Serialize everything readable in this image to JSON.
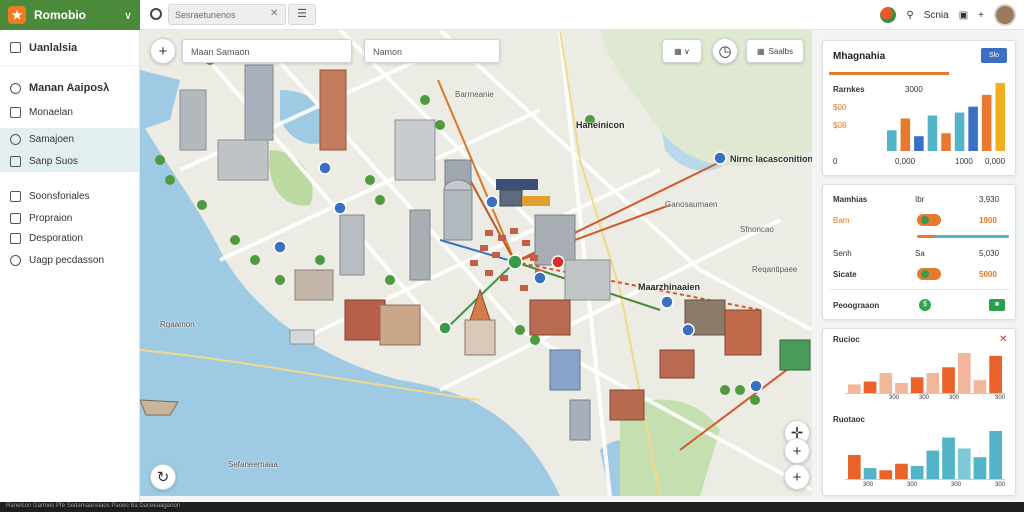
{
  "app": {
    "brand": "Romobio",
    "top_search_placeholder": "Sesraetunenos",
    "top_right_text": "Scnia",
    "top_right_extra": "+"
  },
  "sidebar": {
    "header": "Uanlalsia",
    "items": [
      {
        "label": "Manan Aaiposλ",
        "icon": "user-icon"
      },
      {
        "label": "Monaelan",
        "icon": "calendar-icon"
      },
      {
        "label": "Samajoen",
        "icon": "search-icon"
      },
      {
        "label": "Sanp Suos",
        "icon": "grid-icon"
      },
      {
        "label": "Soonsforiales",
        "icon": "tag-icon"
      },
      {
        "label": "Propraion",
        "icon": "folder-icon"
      },
      {
        "label": "Desporation",
        "icon": "list-icon"
      },
      {
        "label": "Uagp pecdasson",
        "icon": "bolt-icon"
      }
    ]
  },
  "map": {
    "search1": "Maan Samaon",
    "search2": "Namon",
    "labels": {
      "l1": "Haneinicon",
      "l2": "Nirnc Iacasconition",
      "l3": "Maarzhinaaien",
      "l4": "Ganosaumaen",
      "l5": "Barmeanie"
    },
    "small_labels": [
      "Sfnoncao",
      "Reqantipaee",
      "Rgaamon",
      "Sefaneemaaa"
    ],
    "pill2": "Saalbs",
    "zoom_in": "+",
    "zoom_out": "+"
  },
  "panel1": {
    "title": "Mhagnahia",
    "badge": "Slo",
    "rows": [
      {
        "left": "Rarnkes",
        "right": "3000"
      },
      {
        "left": "$00",
        "right": ""
      },
      {
        "left": "$08",
        "right": ""
      },
      {
        "left": "0",
        "right": "0,000"
      }
    ],
    "axis": [
      "1000",
      "0,000"
    ],
    "chart_values": [
      14,
      22,
      10,
      24,
      12,
      26,
      30,
      38,
      46
    ]
  },
  "panel2": {
    "rows": [
      {
        "label": "Mamhias",
        "mid": "Ibr",
        "value": "3,930"
      },
      {
        "label": "Bam",
        "mid": "",
        "value": "1900"
      },
      {
        "label": "Senh",
        "mid": "Sa",
        "value": "5,030"
      },
      {
        "label": "Sicate",
        "mid": "",
        "value": "5000"
      }
    ],
    "footer_label": "Peoograaon"
  },
  "panel3": {
    "title1": "Rucioc",
    "title2": "Ruotaoc",
    "axis1": [
      "300",
      "300",
      "300",
      "300"
    ],
    "axis2": [
      "300",
      "300",
      "300",
      "300"
    ],
    "chart1": [
      6,
      8,
      14,
      7,
      11,
      14,
      18,
      28,
      9,
      26
    ],
    "chart2": [
      22,
      10,
      8,
      14,
      12,
      26,
      38,
      28,
      20,
      44
    ]
  },
  "colors": {
    "brand": "#4a8a3a",
    "accent": "#e87a30",
    "blue": "#3b6fc4",
    "teal": "#53b3c8",
    "yellow": "#f0b021"
  },
  "footer": "Ranelcon Garmes  Pfe Sedamaansiaos  Paoeo  Ba  Daceeaagaoon"
}
